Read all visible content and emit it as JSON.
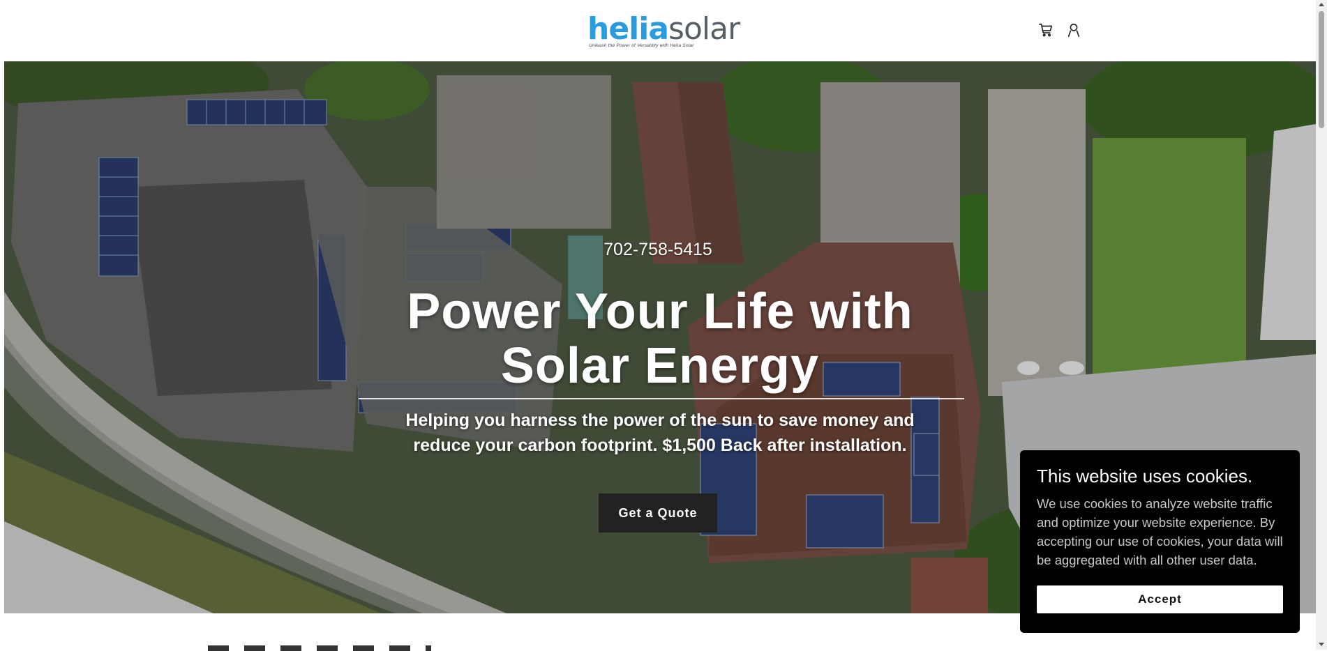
{
  "header": {
    "logo": {
      "brand_part1": "helia",
      "brand_part2": "solar",
      "tagline": "Unleash the Power of Versatility with Helia Solar"
    },
    "icons": [
      "cart-icon",
      "user-icon"
    ]
  },
  "hero": {
    "phone": "702-758-5415",
    "headline": "Power Your Life with Solar Energy",
    "subtitle": "Helping you harness the power of the sun to save money and reduce your carbon footprint. $1,500 Back after installation.",
    "cta_label": "Get a Quote"
  },
  "cookie_banner": {
    "title": "This website uses cookies.",
    "body": "We use cookies to analyze website traffic and optimize your website experience. By accepting our use of cookies, your data will be aggregated with all other user data.",
    "accept_label": "Accept"
  },
  "colors": {
    "brand_blue": "#2b9be0",
    "brand_gray": "#555e66",
    "cta_background": "#222222",
    "cookie_background": "#000000"
  }
}
